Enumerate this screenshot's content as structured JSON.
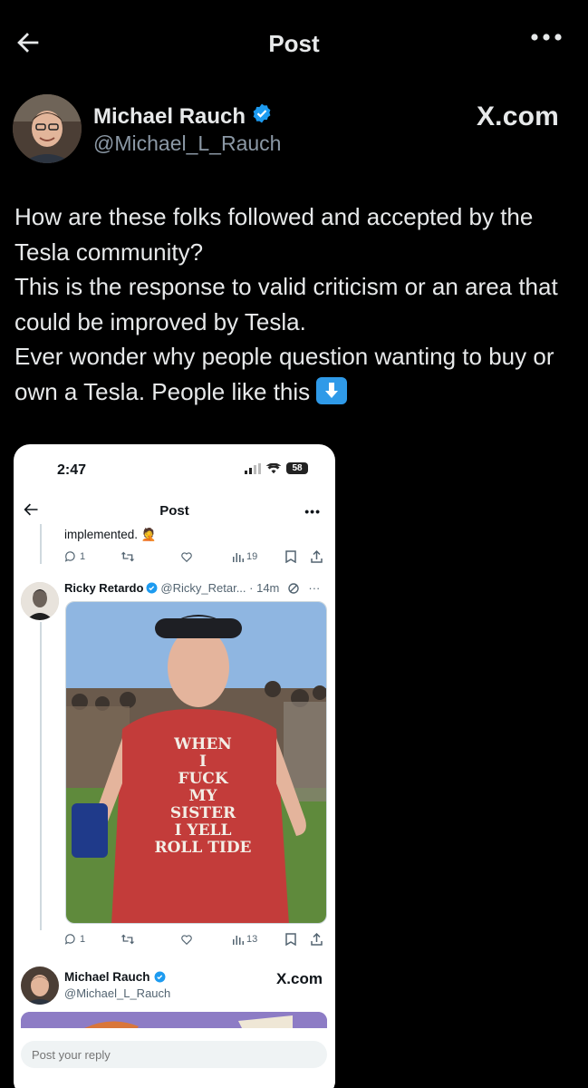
{
  "header": {
    "title": "Post"
  },
  "author": {
    "name": "Michael Rauch",
    "handle": "@Michael_L_Rauch",
    "site": "X.com"
  },
  "post": {
    "lines": [
      "How are these folks followed and accepted by the Tesla community?",
      "This is the response to valid criticism or an area that could be improved by Tesla.",
      "Ever wonder why people question wanting to buy or own a Tesla.  People like this"
    ]
  },
  "embedded_screenshot": {
    "status_time": "2:47",
    "battery": "58",
    "title": "Post",
    "thread_text": "implemented.",
    "actions_1": {
      "replies": "1",
      "views": "19"
    },
    "reply_author": "Ricky Retardo",
    "reply_handle_time": "@Ricky_Retar... · 14m",
    "shirt_text": [
      "WHEN",
      "I",
      "FUCK",
      "MY",
      "SISTER",
      "I YELL",
      "ROLL TIDE"
    ],
    "actions_2": {
      "replies": "1",
      "views": "13"
    },
    "quote_author": "Michael Rauch",
    "quote_handle": "@Michael_L_Rauch",
    "quote_site": "X.com",
    "reply_placeholder": "Post your reply"
  },
  "colors": {
    "background": "#000000",
    "text": "#e7e9ea",
    "muted": "#8b98a5",
    "verified": "#1d9bf0"
  }
}
